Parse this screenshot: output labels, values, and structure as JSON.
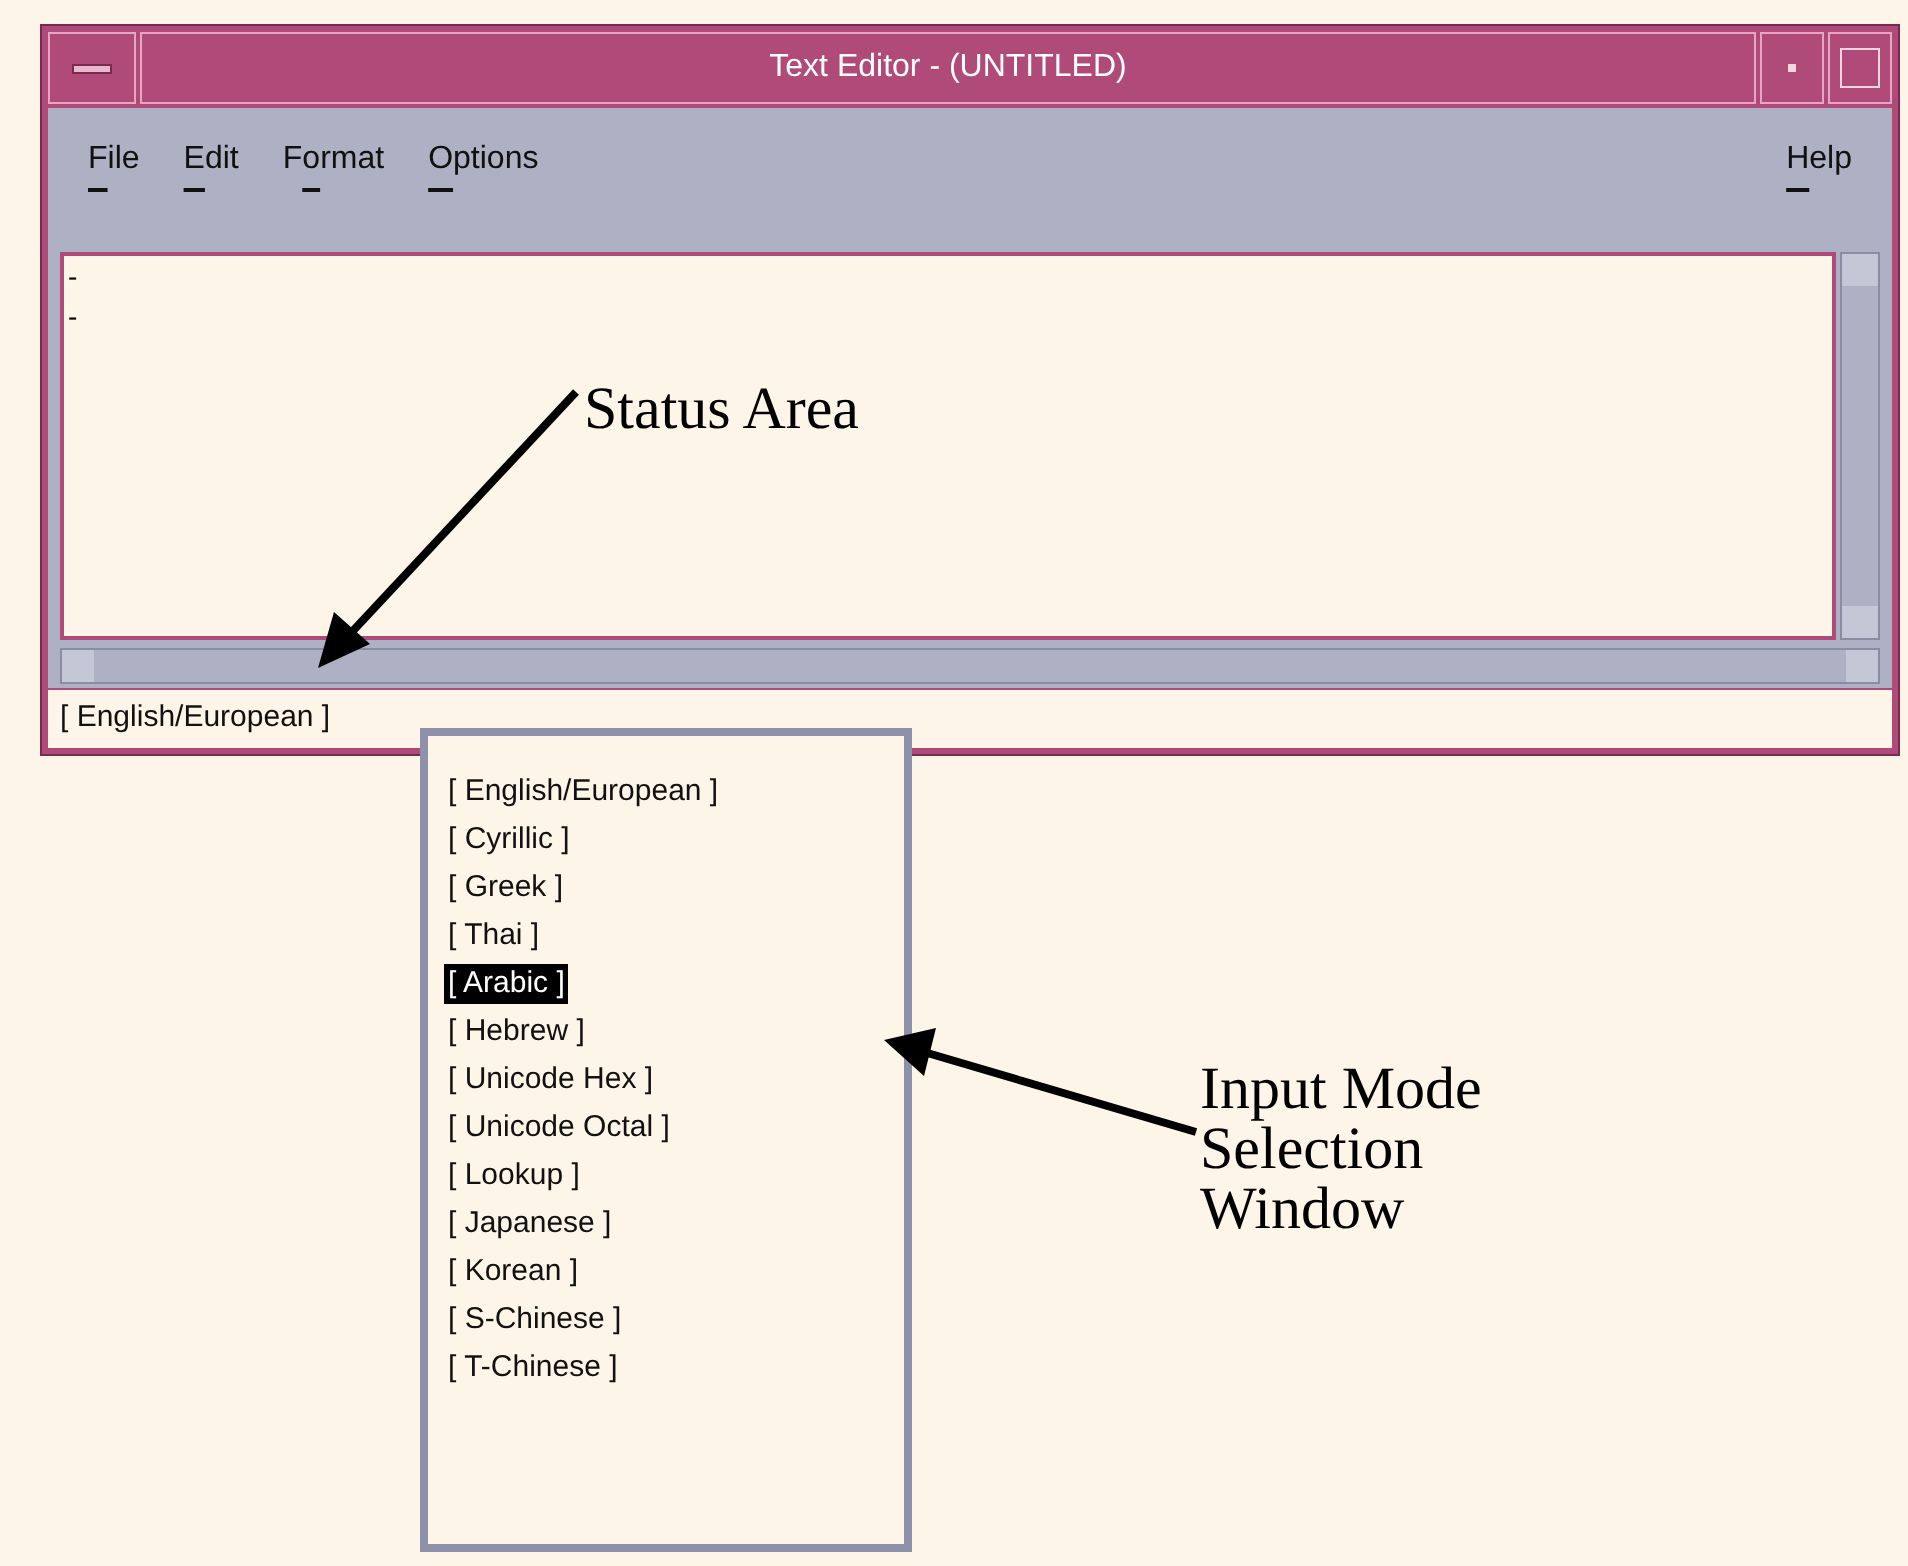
{
  "window": {
    "title": "Text Editor - (UNTITLED)"
  },
  "menu_bar": {
    "left": [
      {
        "key": "F",
        "after": "ile"
      },
      {
        "key": "E",
        "after": "dit"
      },
      {
        "before": "F",
        "key": "o",
        "after": "rmat"
      },
      {
        "key": "O",
        "after": "ptions"
      }
    ],
    "right": [
      {
        "key": "H",
        "after": "elp"
      }
    ]
  },
  "text_area": {
    "lines": [
      "-",
      "-"
    ]
  },
  "status_area": {
    "input_mode": "[ English/European ]"
  },
  "input_mode_window": {
    "items": [
      {
        "label": "[ English/European ]",
        "selected": false
      },
      {
        "label": "[ Cyrillic ]",
        "selected": false
      },
      {
        "label": "[ Greek ]",
        "selected": false
      },
      {
        "label": "[ Thai ]",
        "selected": false
      },
      {
        "label": "[ Arabic ]",
        "selected": true
      },
      {
        "label": "[ Hebrew ]",
        "selected": false
      },
      {
        "label": "[ Unicode Hex ]",
        "selected": false
      },
      {
        "label": "[ Unicode Octal ]",
        "selected": false
      },
      {
        "label": "[ Lookup ]",
        "selected": false
      },
      {
        "label": "[ Japanese ]",
        "selected": false
      },
      {
        "label": "[ Korean ]",
        "selected": false
      },
      {
        "label": "[ S-Chinese ]",
        "selected": false
      },
      {
        "label": "[ T-Chinese ]",
        "selected": false
      }
    ]
  },
  "callouts": [
    {
      "text": "Status Area"
    },
    {
      "text": "Input Mode Selection Window"
    }
  ]
}
